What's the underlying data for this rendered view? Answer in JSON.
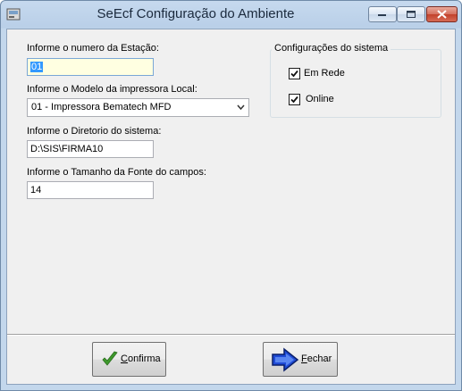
{
  "window": {
    "title": "SeEcf Configuração do Ambiente"
  },
  "station": {
    "label": "Informe o numero da Estação:",
    "value": "01"
  },
  "printer": {
    "label": "Informe o Modelo da impressora Local:",
    "selected": "01 - Impressora Bematech MFD"
  },
  "directory": {
    "label": "Informe o Diretorio do sistema:",
    "value": "D:\\SIS\\FIRMA10"
  },
  "font_size": {
    "label": "Informe o Tamanho da Fonte do campos:",
    "value": "14"
  },
  "system_config": {
    "title": "Configurações do sistema",
    "em_rede": {
      "label": "Em Rede",
      "checked": true
    },
    "online": {
      "label": "Online",
      "checked": true
    }
  },
  "buttons": {
    "confirma": {
      "mnemonic": "C",
      "rest": "onfirma"
    },
    "fechar": {
      "mnemonic": "F",
      "rest": "echar"
    }
  }
}
